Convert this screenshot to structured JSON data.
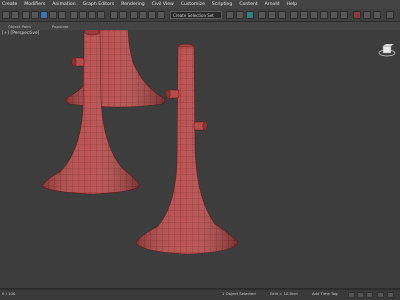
{
  "menu": [
    "Create",
    "Modifiers",
    "Animation",
    "Graph Editors",
    "Rendering",
    "Civil View",
    "Customize",
    "Scripting",
    "Content",
    "Arnold",
    "Help"
  ],
  "toolbar": {
    "selection_set_placeholder": "Create Selection Set"
  },
  "subbar": {
    "left_label": "Object Paint",
    "right_label": "Populate"
  },
  "viewport": {
    "label": "[+] [Perspective]"
  },
  "statusbar": {
    "left": "0 / 100",
    "add_time_tag": "Add Time Tag",
    "mid_left": "1 Object Selected",
    "mid_right": "Grid = 10.0cm"
  },
  "colors": {
    "mesh_fill": "#b84b4b",
    "mesh_wire": "#7a1f1f",
    "background": "#3d3d3d"
  }
}
